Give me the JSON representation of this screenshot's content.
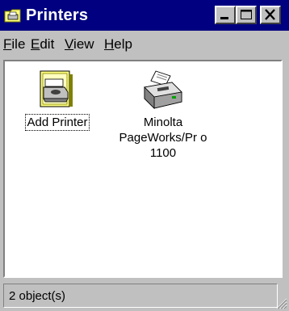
{
  "window": {
    "title": "Printers"
  },
  "menubar": {
    "items": [
      {
        "accel": "F",
        "rest": "ile"
      },
      {
        "accel": "E",
        "rest": "dit"
      },
      {
        "accel": "V",
        "rest": "iew"
      },
      {
        "accel": "H",
        "rest": "elp"
      }
    ]
  },
  "icons": [
    {
      "label": "Add Printer",
      "icon": "add-printer-icon",
      "selected": true
    },
    {
      "label": "Minolta PageWorks/Pr o 1100",
      "icon": "printer-icon",
      "selected": false
    }
  ],
  "status": {
    "text": "2 object(s)"
  },
  "colors": {
    "title_bar": "#000080",
    "face": "#c0c0c0",
    "content_bg": "#ffffff"
  }
}
